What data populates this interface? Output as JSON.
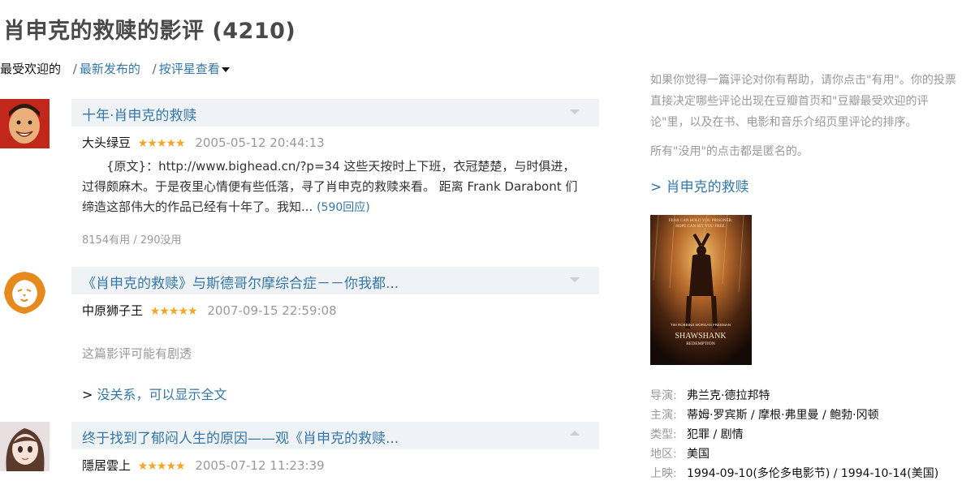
{
  "page": {
    "title_prefix": "肖申克的救赎的影评",
    "count": "(4210)"
  },
  "sort": {
    "current": "最受欢迎的",
    "sep1": "/",
    "newest": "最新发布的",
    "sep2": "/",
    "by_rating": "按评星查看"
  },
  "reviews": [
    {
      "title": "十年·肖申克的救赎",
      "author": "大头绿豆",
      "rating": 5,
      "stars": "★★★★★",
      "date": "2005-05-12 20:44:13",
      "excerpt": "{原文}：http://www.bighead.cn/?p=34 这些天按时上下班，衣冠楚楚，与时俱进，过得颇麻木。于是夜里心情便有些低落，寻了肖申克的救赎来看。 距离 Frank Darabont 们缔造这部伟大的作品已经有十年了。我知...",
      "replies": "(590回应)",
      "votes": "8154有用 / 290没用"
    },
    {
      "title": "《肖申克的救赎》与斯德哥尔摩综合症－－你我都...",
      "author": "中原狮子王",
      "rating": 5,
      "stars": "★★★★★",
      "date": "2007-09-15 22:59:08",
      "spoiler": "这篇影评可能有剧透",
      "show_full_prefix": ">",
      "show_full": "没关系，可以显示全文"
    },
    {
      "title": "终于找到了郁闷人生的原因——观《肖申克的救赎...",
      "author": "隱居雲上",
      "rating": 5,
      "stars": "★★★★★",
      "date": "2005-07-12 11:23:39"
    }
  ],
  "aside": {
    "help": "如果你觉得一篇评论对你有帮助，请你点击\"有用\"。你的投票直接决定哪些评论出现在豆瓣首页和\"豆瓣最受欢迎的评论\"里，以及在书、电影和音乐介绍页里评论的排序。",
    "anon": "所有\"没用\"的点击都是匿名的。",
    "movie_link": "> 肖申克的救赎",
    "poster_text": {
      "tagline1": "FEAR CAN HOLD YOU PRISONER.",
      "tagline2": "HOPE CAN SET YOU FREE.",
      "actors": "TIM ROBBINS    MORGAN FREEMAN",
      "title1": "SHAWSHANK",
      "title2": "REDEMPTION"
    },
    "info": [
      {
        "label": "导演:",
        "value": "弗兰克·德拉邦特"
      },
      {
        "label": "主演:",
        "value": "蒂姆·罗宾斯 / 摩根·弗里曼 / 鲍勃·冈顿"
      },
      {
        "label": "类型:",
        "value": "犯罪 / 剧情"
      },
      {
        "label": "地区:",
        "value": "美国"
      },
      {
        "label": "上映:",
        "value": "1994-09-10(多伦多电影节) / 1994-10-14(美国)"
      }
    ]
  },
  "colors": {
    "link": "#3377aa",
    "star": "#f5a623",
    "muted": "#999999",
    "title": "#494949",
    "panel": "#f0f3f5"
  }
}
